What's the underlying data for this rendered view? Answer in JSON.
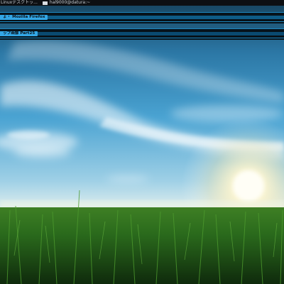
{
  "top_panel": {
    "tasks": [
      {
        "label": "Linuxデスクトッ...",
        "icon": "window-icon"
      },
      {
        "label": "hal9000@datura:~",
        "icon": "terminal-icon"
      }
    ]
  },
  "windows": [
    {
      "title": "ょ・ Mozilla Firefox"
    },
    {
      "title": "ップ画像 Part25"
    }
  ],
  "wallpaper": {
    "subject": "grass field under blue sky with sun",
    "colors": {
      "sky_top": "#1b4f6e",
      "sky_mid": "#3f94c7",
      "horizon": "#dfeef2",
      "sun": "#fffbe6",
      "grass": "#2f7d1f"
    }
  }
}
